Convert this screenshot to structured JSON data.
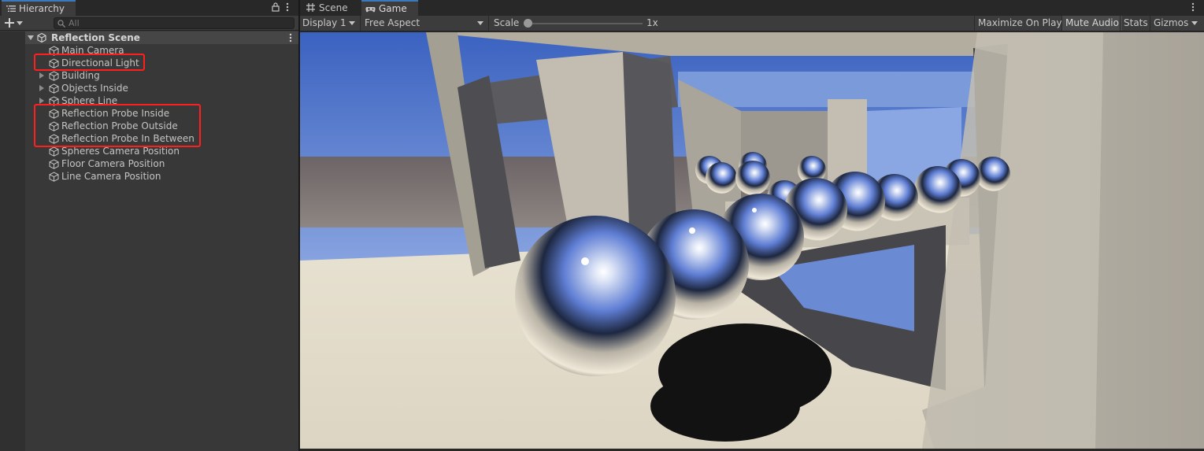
{
  "hierarchy": {
    "tab_label": "Hierarchy",
    "search_placeholder": "All",
    "scene_name": "Reflection Scene",
    "items": [
      {
        "label": "Main Camera",
        "expandable": false
      },
      {
        "label": "Directional Light",
        "expandable": false
      },
      {
        "label": "Building",
        "expandable": true
      },
      {
        "label": "Objects Inside",
        "expandable": true
      },
      {
        "label": "Sphere Line",
        "expandable": true
      },
      {
        "label": "Reflection Probe Inside",
        "expandable": false
      },
      {
        "label": "Reflection Probe Outside",
        "expandable": false
      },
      {
        "label": "Reflection Probe In Between",
        "expandable": false
      },
      {
        "label": "Spheres Camera Position",
        "expandable": false
      },
      {
        "label": "Floor Camera Position",
        "expandable": false
      },
      {
        "label": "Line Camera Position",
        "expandable": false
      }
    ]
  },
  "game_view": {
    "tabs": [
      {
        "label": "Scene",
        "icon": "grid-icon",
        "active": false
      },
      {
        "label": "Game",
        "icon": "gamepad-icon",
        "active": true
      }
    ],
    "display": "Display 1",
    "aspect": "Free Aspect",
    "scale_label": "Scale",
    "scale_value": "1x",
    "scale_fraction": 0.0,
    "buttons": {
      "maximize": "Maximize On Play",
      "mute": "Mute Audio",
      "stats": "Stats",
      "gizmos": "Gizmos"
    },
    "mute_audio_on": true
  },
  "colors": {
    "accent_tab": "#3a79bb",
    "highlight_box": "#ff1f1f",
    "panel_bg": "#383838",
    "sky_top": "#3f66c2",
    "floor": "#e2dbcb"
  }
}
